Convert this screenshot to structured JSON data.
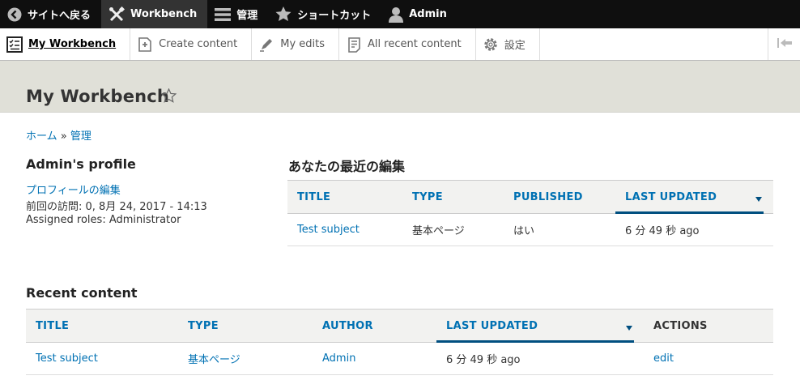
{
  "toolbar": {
    "items": [
      {
        "label": "サイトへ戻る",
        "icon": "back-circle-icon"
      },
      {
        "label": "Workbench",
        "icon": "tools-icon"
      },
      {
        "label": "管理",
        "icon": "menu-icon"
      },
      {
        "label": "ショートカット",
        "icon": "star-icon"
      },
      {
        "label": "Admin",
        "icon": "user-icon"
      }
    ]
  },
  "tray": {
    "items": [
      {
        "label": "My Workbench",
        "icon": "checklist-icon"
      },
      {
        "label": "Create content",
        "icon": "add-document-icon"
      },
      {
        "label": "My edits",
        "icon": "pencil-icon"
      },
      {
        "label": "All recent content",
        "icon": "documents-icon"
      },
      {
        "label": "設定",
        "icon": "gear-icon"
      }
    ],
    "collapse_icon": "collapse-left-icon"
  },
  "page": {
    "title": "My Workbench"
  },
  "breadcrumb": {
    "home": "ホーム",
    "separator": "»",
    "admin": "管理"
  },
  "profile": {
    "title": "Admin's profile",
    "edit_link": "プロフィールの編集",
    "last_access": "前回の訪問: 0, 8月 24, 2017 - 14:13",
    "roles": "Assigned roles: Administrator"
  },
  "my_edits": {
    "title": "あなたの最近の編集",
    "columns": [
      "TITLE",
      "TYPE",
      "PUBLISHED",
      "LAST UPDATED"
    ],
    "rows": [
      {
        "title": "Test subject",
        "type": "基本ページ",
        "published": "はい",
        "updated": "6 分 49 秒 ago"
      }
    ]
  },
  "recent": {
    "title": "Recent content",
    "columns": [
      "TITLE",
      "TYPE",
      "AUTHOR",
      "LAST UPDATED",
      "ACTIONS"
    ],
    "rows": [
      {
        "title": "Test subject",
        "type": "基本ページ",
        "author": "Admin",
        "updated": "6 分 49 秒 ago",
        "action": "edit"
      }
    ]
  },
  "colors": {
    "link": "#0071b3",
    "toolbar_bg": "#0f0f0f",
    "header_bg": "#e0e0d8"
  }
}
